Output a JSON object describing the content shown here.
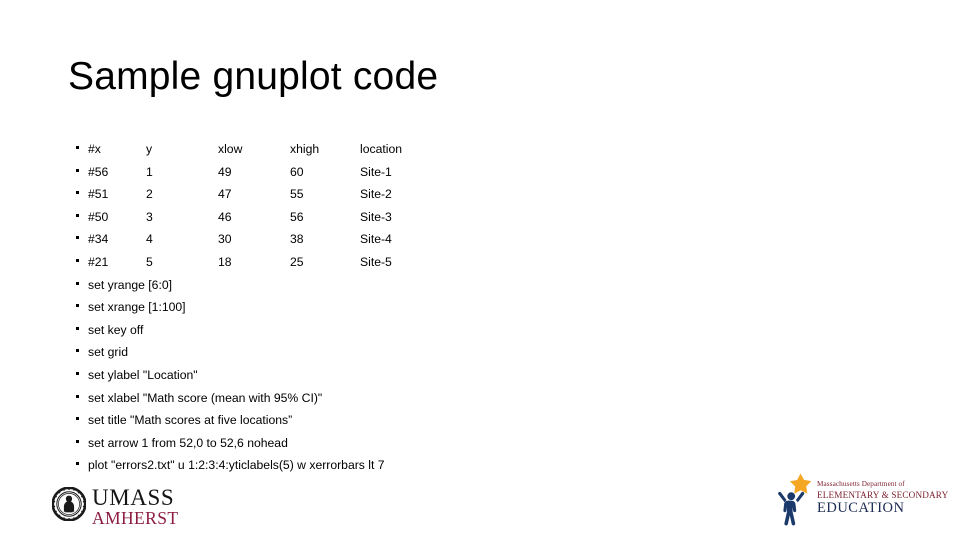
{
  "slide": {
    "title": "Sample gnuplot code"
  },
  "table": {
    "header": {
      "x": "#x",
      "y": "y",
      "xlow": "xlow",
      "xhigh": "xhigh",
      "location": "location"
    },
    "rows": [
      {
        "x": "#56",
        "y": "1",
        "xlow": "49",
        "xhigh": "60",
        "location": "Site-1"
      },
      {
        "x": "#51",
        "y": "2",
        "xlow": "47",
        "xhigh": "55",
        "location": "Site-2"
      },
      {
        "x": "#50",
        "y": "3",
        "xlow": "46",
        "xhigh": "56",
        "location": "Site-3"
      },
      {
        "x": "#34",
        "y": "4",
        "xlow": "30",
        "xhigh": "38",
        "location": "Site-4"
      },
      {
        "x": "#21",
        "y": "5",
        "xlow": "18",
        "xhigh": "25",
        "location": "Site-5"
      }
    ]
  },
  "commands": [
    "set yrange [6:0]",
    "set xrange [1:100]",
    "set key off",
    "set grid",
    "set ylabel \"Location\"",
    "set xlabel \"Math score (mean with 95% CI)\"",
    "set title \"Math scores at five locations”",
    "set arrow 1 from 52,0 to 52,6 nohead",
    "plot \"errors2.txt\" u 1:2:3:4:yticlabels(5) w xerrorbars lt 7"
  ],
  "logos": {
    "umass": {
      "top": "UMASS",
      "bottom": "AMHERST",
      "seal_color": "#1a1a1a",
      "bottom_color": "#8c1d40"
    },
    "dese": {
      "line1": "Massachusetts Department of",
      "line2": "ELEMENTARY & SECONDARY",
      "line3": "EDUCATION",
      "star_color": "#f5a623",
      "figure_color": "#1b3a6b",
      "text_color": "#7d2230",
      "education_color": "#1b2a52"
    }
  }
}
